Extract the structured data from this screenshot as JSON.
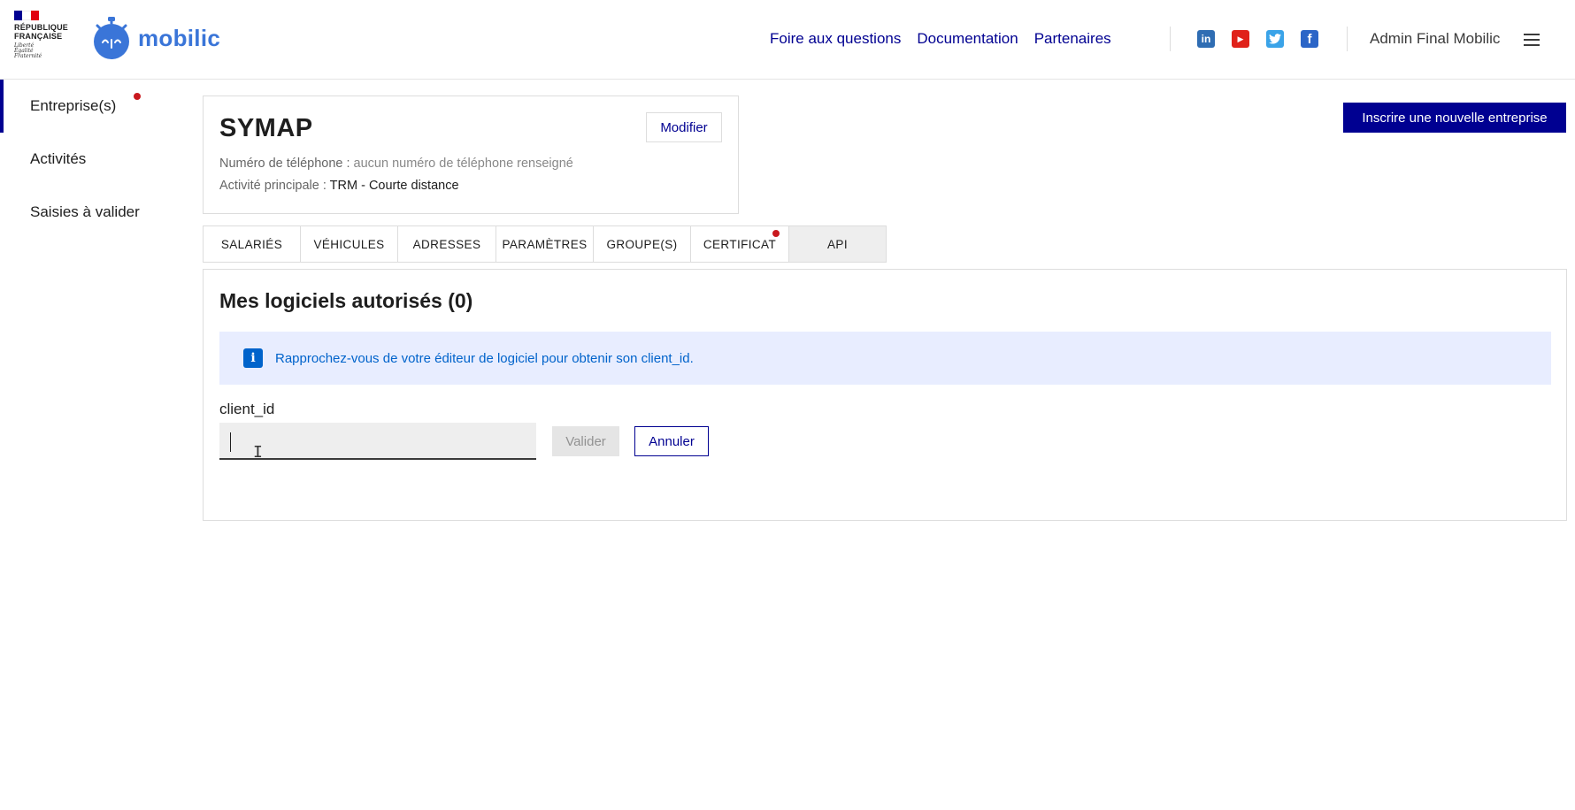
{
  "header": {
    "republic_line1": "RÉPUBLIQUE",
    "republic_line2": "FRANÇAISE",
    "motto": [
      "Liberté",
      "Égalité",
      "Fraternité"
    ],
    "brand": "mobilic",
    "nav": [
      "Foire aux questions",
      "Documentation",
      "Partenaires"
    ],
    "social": [
      {
        "name": "linkedin-icon",
        "glyph": "in",
        "color": "#2f6db3"
      },
      {
        "name": "youtube-icon",
        "glyph": "▶",
        "color": "#e0221a"
      },
      {
        "name": "twitter-icon",
        "glyph": "🐦",
        "color": "#3aa3e8"
      },
      {
        "name": "facebook-icon",
        "glyph": "f",
        "color": "#2b65c7"
      }
    ],
    "user": "Admin Final Mobilic"
  },
  "sidebar": {
    "items": [
      {
        "label": "Entreprise(s)",
        "active": true,
        "notification": true
      },
      {
        "label": "Activités",
        "active": false,
        "notification": false
      },
      {
        "label": "Saisies à valider",
        "active": false,
        "notification": false
      }
    ]
  },
  "company": {
    "name": "SYMAP",
    "modify_label": "Modifier",
    "phone_label": "Numéro de téléphone : ",
    "phone_value": "aucun numéro de téléphone renseigné",
    "activity_label": "Activité principale : ",
    "activity_value": "TRM - Courte distance"
  },
  "new_company_label": "Inscrire une nouvelle entreprise",
  "tabs": [
    {
      "label": "SALARIÉS",
      "active": false,
      "notification": false
    },
    {
      "label": "VÉHICULES",
      "active": false,
      "notification": false
    },
    {
      "label": "ADRESSES",
      "active": false,
      "notification": false
    },
    {
      "label": "PARAMÈTRES",
      "active": false,
      "notification": false
    },
    {
      "label": "GROUPE(S)",
      "active": false,
      "notification": false
    },
    {
      "label": "CERTIFICAT",
      "active": false,
      "notification": true
    },
    {
      "label": "API",
      "active": true,
      "notification": false
    }
  ],
  "api": {
    "title": "Mes logiciels autorisés (0)",
    "info": "Rapprochez-vous de votre éditeur de logiciel pour obtenir son client_id.",
    "field_label": "client_id",
    "field_value": "",
    "validate_label": "Valider",
    "cancel_label": "Annuler"
  },
  "colors": {
    "primary": "#000091",
    "brand": "#3a75d8",
    "notification": "#c9191e",
    "info_bg": "#e8edff",
    "info_text": "#0063cb"
  }
}
